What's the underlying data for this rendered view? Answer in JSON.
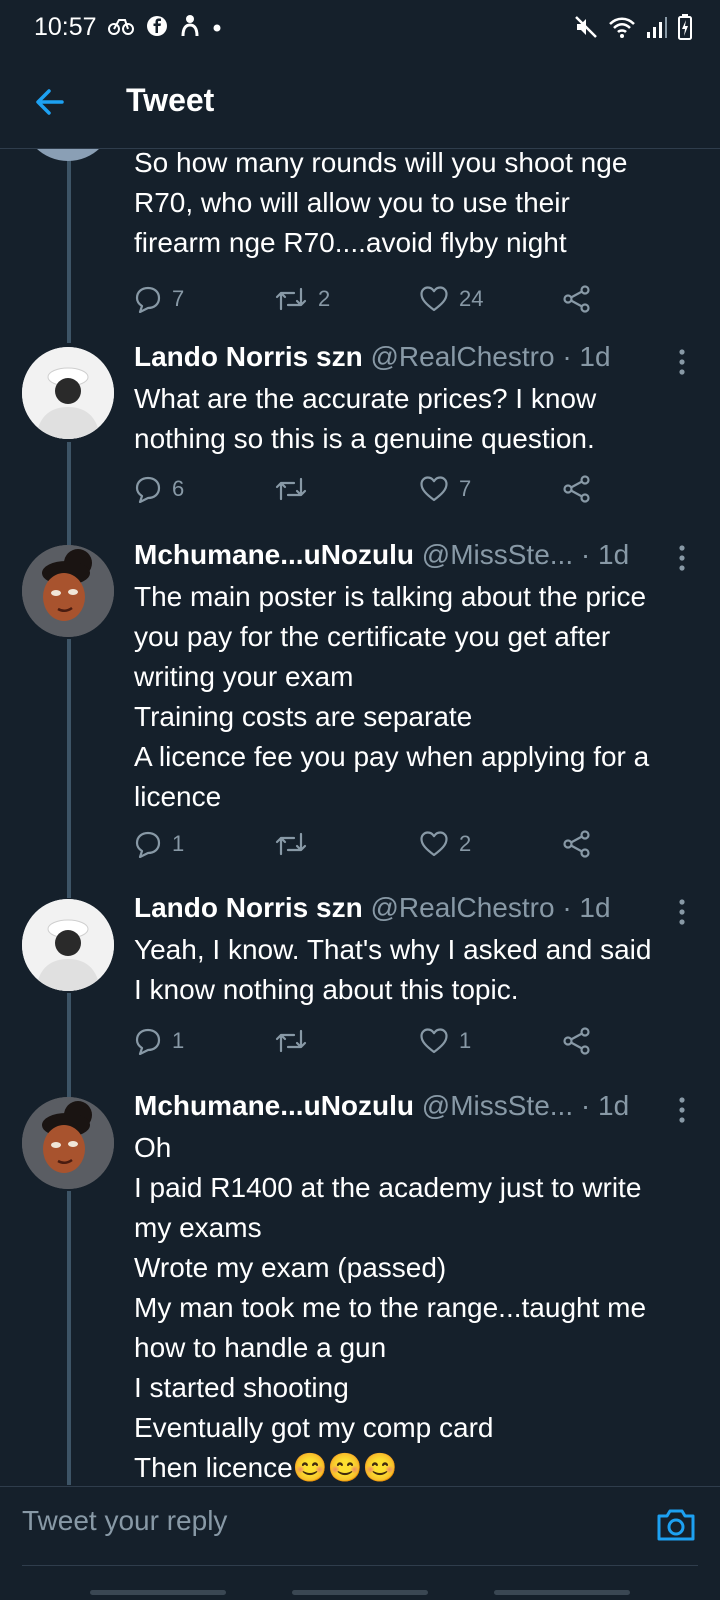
{
  "status_bar": {
    "time": "10:57"
  },
  "header": {
    "title": "Tweet",
    "back_icon": "arrow-left-icon"
  },
  "tweets": [
    {
      "name": "",
      "handle": "",
      "time": "",
      "text": "So how many rounds will you shoot nge\nR70, who will allow you to use their\nfirearm nge R70....avoid flyby night",
      "replies": "7",
      "retweets": "2",
      "likes": "24"
    },
    {
      "name": "Lando Norris szn",
      "handle": "@RealChestro",
      "time": "· 1d",
      "text": "What are the accurate prices? I know\nnothing so this is a genuine question.",
      "replies": "6",
      "retweets": "",
      "likes": "7"
    },
    {
      "name": "Mchumane...uNozulu",
      "handle": "@MissSte...",
      "time": "· 1d",
      "text": "The main poster is talking about the price\nyou pay for the certificate you get after\nwriting your exam\nTraining costs are separate\nA licence fee you pay when applying for a\nlicence",
      "replies": "1",
      "retweets": "",
      "likes": "2"
    },
    {
      "name": "Lando Norris szn",
      "handle": "@RealChestro",
      "time": "· 1d",
      "text": "Yeah, I know. That's why I asked and said\nI know nothing about this topic.",
      "replies": "1",
      "retweets": "",
      "likes": "1"
    },
    {
      "name": "Mchumane...uNozulu",
      "handle": "@MissSte...",
      "time": "· 1d",
      "text": "Oh\nI paid R1400 at the academy just to write\nmy exams\nWrote my exam (passed)\nMy man took me to the range...taught me\nhow to handle a gun\nI started shooting\nEventually got my comp card\nThen licence😊😊😊",
      "replies": "",
      "retweets": "",
      "likes": ""
    }
  ],
  "reply_bar": {
    "placeholder": "Tweet your reply",
    "camera_icon": "camera-icon"
  },
  "colors": {
    "accent": "#1da1f2",
    "background": "#15202b",
    "muted": "#8899a6",
    "divider": "#2f3d4c"
  }
}
